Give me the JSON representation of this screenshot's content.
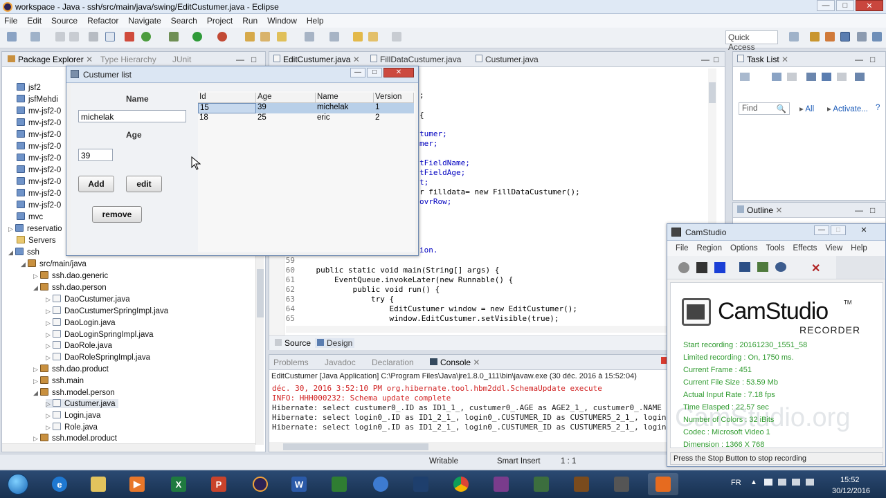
{
  "window": {
    "title": "workspace - Java - ssh/src/main/java/swing/EditCustumer.java - Eclipse"
  },
  "menu": [
    "File",
    "Edit",
    "Source",
    "Refactor",
    "Navigate",
    "Search",
    "Project",
    "Run",
    "Window",
    "Help"
  ],
  "toolbar": {
    "quick_access": "Quick Access"
  },
  "left_panel": {
    "tabs": [
      "Package Explorer",
      "Type Hierarchy",
      "JUnit"
    ],
    "tree": [
      "jsf2",
      "jsfMehdi",
      "mv-jsf2-0",
      "mv-jsf2-0",
      "mv-jsf2-0",
      "mv-jsf2-0",
      "mv-jsf2-0",
      "mv-jsf2-0",
      "mv-jsf2-0",
      "mv-jsf2-0",
      "mv-jsf2-0",
      "mvc",
      "reservatio",
      "Servers",
      "ssh",
      "src/main/java",
      "ssh.dao.generic",
      "ssh.dao.person",
      "DaoCustumer.java",
      "DaoCustumerSpringImpl.java",
      "DaoLogin.java",
      "DaoLoginSpringImpl.java",
      "DaoRole.java",
      "DaoRoleSpringImpl.java",
      "ssh.dao.product",
      "ssh.main",
      "ssh.model.person",
      "Custumer.java",
      "Login.java",
      "Role.java",
      "ssh.model.product"
    ]
  },
  "editor": {
    "tabs": [
      "EditCustumer.java",
      "FillDataCustumer.java",
      "Custumer.java"
    ],
    "partial_lines": [
      ";",
      "{",
      "tumer;",
      "mer;",
      "tFieldName;",
      "tFieldAge;",
      "t;",
      "r filldata= new FillDataCustumer();",
      "ovrRow;",
      "ion."
    ],
    "code": [
      {
        "n": "59",
        "text": ""
      },
      {
        "n": "60",
        "text": "    public static void main(String[] args) {"
      },
      {
        "n": "61",
        "text": "        EventQueue.invokeLater(new Runnable() {"
      },
      {
        "n": "62",
        "text": "            public void run() {"
      },
      {
        "n": "63",
        "text": "                try {"
      },
      {
        "n": "64",
        "text": "                    EditCustumer window = new EditCustumer();"
      },
      {
        "n": "65",
        "text": "                    window.EditCustumer.setVisible(true);"
      }
    ],
    "bottom_tabs": [
      "Source",
      "Design"
    ]
  },
  "console": {
    "tabs": [
      "Problems",
      "Javadoc",
      "Declaration",
      "Console"
    ],
    "header": "EditCustumer [Java Application] C:\\Program Files\\Java\\jre1.8.0_111\\bin\\javaw.exe (30 déc. 2016 à 15:52:04)",
    "lines": [
      {
        "text": "déc. 30, 2016 3:52:10 PM org.hibernate.tool.hbm2ddl.SchemaUpdate execute",
        "color": "red"
      },
      {
        "text": "INFO: HHH000232: Schema update complete",
        "color": "red"
      },
      {
        "text": "Hibernate: select custumer0_.ID as ID1_1_, custumer0_.AGE as AGE2_1_, custumer0_.NAME a",
        "color": "black"
      },
      {
        "text": "Hibernate: select login0_.ID as ID1_2_1_, login0_.CUSTUMER_ID as CUSTUMER5_2_1_, login0",
        "color": "black"
      },
      {
        "text": "Hibernate: select login0_.ID as ID1_2_1_, login0_.CUSTUMER_ID as CUSTUMER5_2_1_, login0",
        "color": "black"
      }
    ]
  },
  "right_panel": {
    "task_list": {
      "title": "Task List",
      "find": "Find",
      "all": "All",
      "activate": "Activate..."
    },
    "outline": {
      "title": "Outline"
    }
  },
  "status": {
    "writable": "Writable",
    "insert": "Smart Insert",
    "position": "1 : 1"
  },
  "custumer_window": {
    "title": "Custumer list",
    "name_label": "Name",
    "name_value": "michelak",
    "age_label": "Age",
    "age_value": "39",
    "add": "Add",
    "edit": "edit",
    "remove": "remove",
    "columns": [
      "Id",
      "Age",
      "Name",
      "Version"
    ],
    "rows": [
      {
        "id": "15",
        "age": "39",
        "name": "michelak",
        "version": "1",
        "selected": true
      },
      {
        "id": "18",
        "age": "25",
        "name": "eric",
        "version": "2",
        "selected": false
      }
    ]
  },
  "camstudio": {
    "title": "CamStudio",
    "menu": [
      "File",
      "Region",
      "Options",
      "Tools",
      "Effects",
      "View",
      "Help"
    ],
    "brand": "CamStudio",
    "tm": "TM",
    "brand_sub": "RECORDER",
    "info": [
      "Start recording : 20161230_1551_58",
      "Limited recording : On, 1750 ms.",
      "Current Frame : 451",
      "Current File Size : 53.59 Mb",
      "Actual Input Rate : 7.18 fps",
      "Time Elasped : 22.57 sec",
      "Number of Colors : 32 iBits",
      "Codec : Microsoft Video 1",
      "Dimension : 1366 X 768"
    ],
    "watermark": "CamStudio.org",
    "status": "Press the Stop Button to stop recording"
  },
  "taskbar": {
    "lang": "FR",
    "time": "15:52",
    "date": "30/12/2016"
  }
}
